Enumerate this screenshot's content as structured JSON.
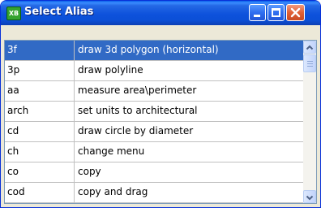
{
  "window": {
    "title": "Select Alias",
    "app_icon": "xb-app-icon",
    "app_icon_text": "XB"
  },
  "title_buttons": [
    "minimize",
    "maximize",
    "close"
  ],
  "aliases": [
    {
      "alias": "3f",
      "description": "draw 3d polygon (horizontal)",
      "selected": true
    },
    {
      "alias": "3p",
      "description": "draw polyline"
    },
    {
      "alias": "aa",
      "description": "measure area\\perimeter"
    },
    {
      "alias": "arch",
      "description": "set units to architectural"
    },
    {
      "alias": "cd",
      "description": "draw circle by diameter"
    },
    {
      "alias": "ch",
      "description": "change menu"
    },
    {
      "alias": "co",
      "description": "copy"
    },
    {
      "alias": "cod",
      "description": "copy and drag"
    }
  ],
  "colors": {
    "selection": "#316ac5",
    "titlebar": "#0b4fd6",
    "close_button": "#e06035"
  }
}
